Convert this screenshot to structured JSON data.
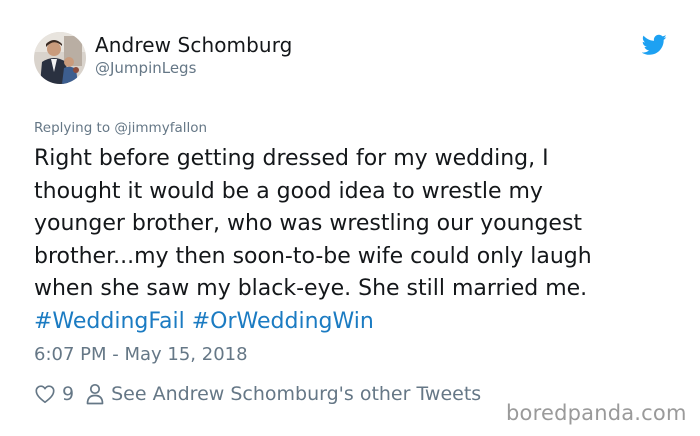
{
  "tweet": {
    "author_name": "Andrew Schomburg",
    "author_handle": "@JumpinLegs",
    "replying_to": "Replying to @jimmyfallon",
    "text_lines": [
      "Right before getting dressed for my wedding, I",
      "thought it would be a good idea to wrestle my",
      "younger brother, who was wrestling our youngest",
      "brother...my then soon-to-be wife could only laugh",
      "when she saw my black-eye. She still married me."
    ],
    "hashtags": [
      "#WeddingFail",
      "#OrWeddingWin"
    ],
    "timestamp": "6:07 PM - May 15, 2018",
    "like_count": "9",
    "other_tweets_link": "See Andrew Schomburg's other Tweets"
  },
  "icons": {
    "brand": "twitter-bird-icon",
    "like": "heart-icon",
    "profile": "person-icon"
  },
  "colors": {
    "hashtag": "#1b7bc2",
    "twitter_blue": "#1da1f2",
    "secondary_text": "#657786"
  },
  "watermark": "boredpanda.com"
}
